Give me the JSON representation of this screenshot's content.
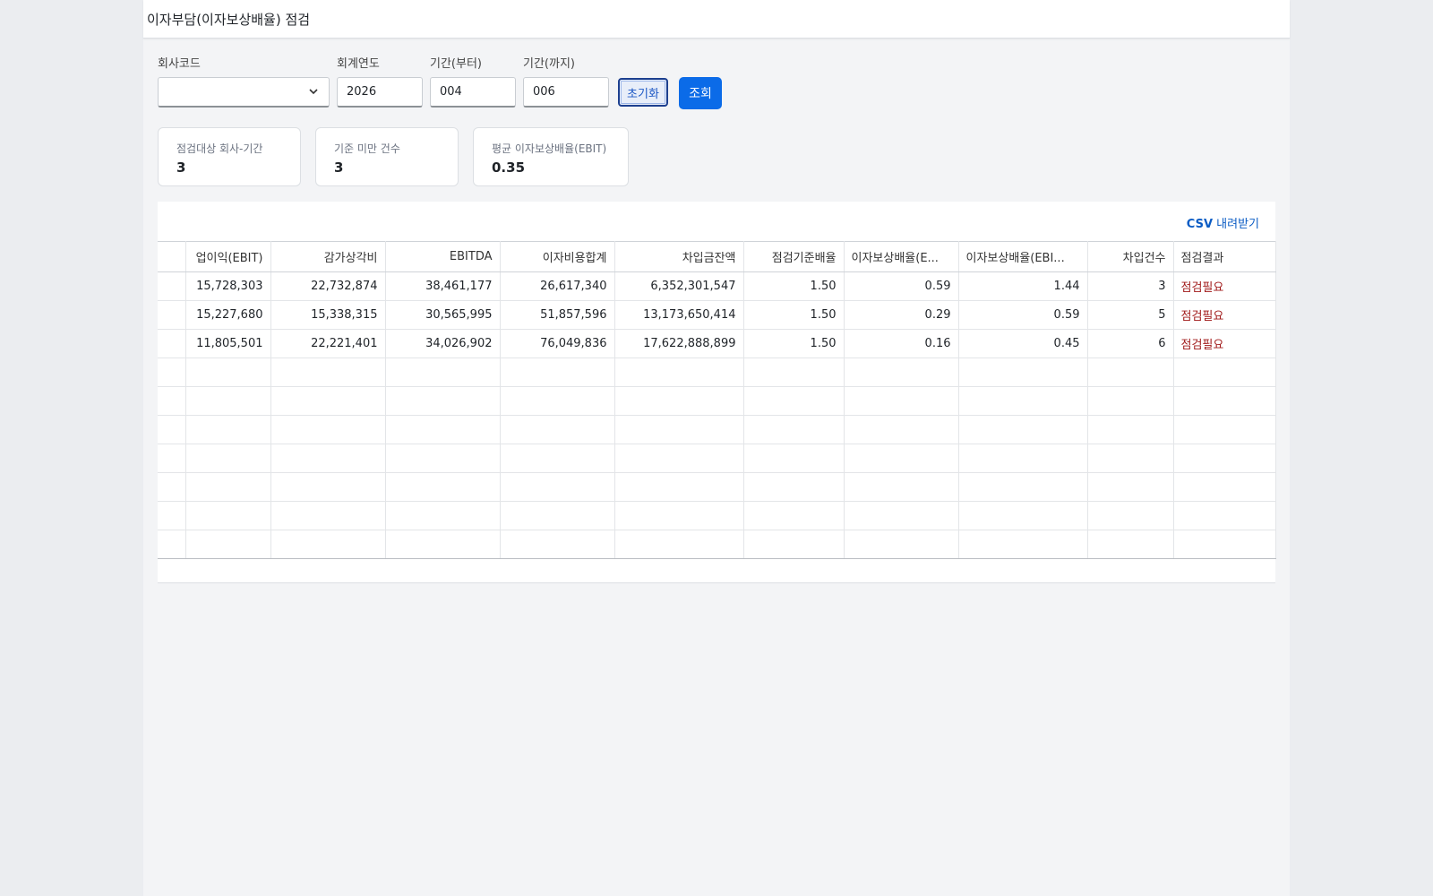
{
  "header": {
    "title": "이자부담(이자보상배율) 점검"
  },
  "filters": {
    "company_label": "회사코드",
    "company_value": "",
    "year_label": "회계연도",
    "year_value": "2026",
    "from_label": "기간(부터)",
    "from_value": "004",
    "to_label": "기간(까지)",
    "to_value": "006",
    "reset_label": "초기화",
    "search_label": "조회",
    "company_icon": "chevron-down-icon"
  },
  "kpis": [
    {
      "label": "점검대상 회사-기간",
      "value": "3"
    },
    {
      "label": "기준 미만 건수",
      "value": "3"
    },
    {
      "label": "평균 이자보상배율(EBIT)",
      "value": "0.35"
    }
  ],
  "grid": {
    "csv_bold": "CSV",
    "csv_rest": " 내려받기",
    "columns": [
      "",
      "업이익(EBIT)",
      "감가상각비",
      "EBITDA",
      "이자비용합계",
      "차입금잔액",
      "점검기준배율",
      "이자보상배율(E...",
      "이자보상배율(EBI...",
      "차입건수",
      "점검결과"
    ],
    "rows": [
      [
        "",
        "15,728,303",
        "22,732,874",
        "38,461,177",
        "26,617,340",
        "6,352,301,547",
        "1.50",
        "0.59",
        "1.44",
        "3",
        "점검필요"
      ],
      [
        "",
        "15,227,680",
        "15,338,315",
        "30,565,995",
        "51,857,596",
        "13,173,650,414",
        "1.50",
        "0.29",
        "0.59",
        "5",
        "점검필요"
      ],
      [
        "",
        "11,805,501",
        "22,221,401",
        "34,026,902",
        "76,049,836",
        "17,622,888,899",
        "1.50",
        "0.16",
        "0.45",
        "6",
        "점검필요"
      ]
    ],
    "empty_rows": 7
  },
  "colors": {
    "accent": "#0b6be8",
    "warning_text": "#a01818",
    "link": "#0b5cc4"
  }
}
